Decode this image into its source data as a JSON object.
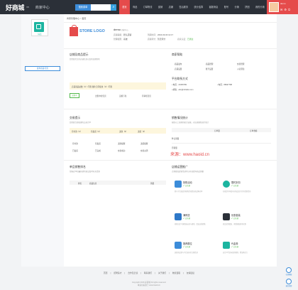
{
  "header": {
    "logo": "好商城",
    "logo_sup": "V5",
    "center_title": "商家中心",
    "search_select": "搜索菜单",
    "nav": [
      "首页",
      "商品",
      "订单物流",
      "促销",
      "店铺",
      "售后服务",
      "统计结算",
      "客服消息",
      "账号",
      "分销",
      "拼团",
      "我的分销",
      "账号服务",
      "账号权限",
      "装修",
      "帮助",
      "官方通道",
      "其它"
    ],
    "active_nav": 0,
    "username": "demo"
  },
  "sidebar": {
    "shop_logo_caption": "好店",
    "publish_button": "发布商品/宝贝"
  },
  "main": {
    "breadcrumb": "商家管理中心 > 首页",
    "store_logo_text": "STORE LOGO",
    "shop_name": "demo",
    "shop_name_badge": "商家中心",
    "shop_level_label": "店铺等级",
    "shop_level": "默认店铺",
    "shop_expire_label": "到期时间",
    "shop_expire": "2016-03-03 12:17",
    "shop_type_label": "管理权限",
    "shop_type": "系统",
    "audit_label": "店铺评分",
    "audit_value": "暂无评分",
    "verify_label": "商家认证",
    "verify_value": "已通过",
    "section_goods": {
      "title": "店铺及商品提示",
      "sub": "您需要关注的店铺信息以及待处理事项",
      "notice": "店铺商品总数（0）/不限   图片空间使用（0）/不限",
      "tag": "出售中",
      "items": [
        "出售中的宝贝",
        "违规下架",
        "待审核宝贝"
      ]
    },
    "section_news": {
      "title": "商家帮助",
      "items": [
        "商品发布",
        "商品管理",
        "交易管理",
        "店铺设置",
        "账号设置",
        "入驻须知"
      ]
    },
    "section_contact": {
      "title": "平台联系方式",
      "phone_label": "电话：",
      "phone": "23456789",
      "mobile_label": "电话：",
      "mobile": "88997788",
      "email_label": "邮箱：",
      "email": "abc@123abc.com"
    },
    "section_orders": {
      "title": "交易提示",
      "sub": "您需要立即处理的交易订单",
      "tabs": [
        "待付款（0）",
        "待发货（0）",
        "退款（0）",
        "退货（0）"
      ],
      "items": [
        "待付款",
        "待发货",
        "退款提醒",
        "退货提醒",
        "已发货",
        "已完成",
        "交易成功",
        "交易关闭"
      ]
    },
    "section_sales": {
      "title": "销售情况统计",
      "sub": "按照以上日期的统计结果，对店铺销售进行统计",
      "col1": "订单量",
      "col2": "订单金额",
      "rows": [
        "昨日销量",
        "月销量"
      ]
    },
    "section_rank": {
      "title": "单品销售排名",
      "sub": "掌握近30日最热销的商品及时补充货源",
      "cols": [
        "排名",
        "商品信息",
        "销量"
      ]
    },
    "section_promo": {
      "title": "店铺运营推广",
      "sub": "合理参加促销活动可以有效提升商品销量",
      "tiles": [
        {
          "title": "抢购活动",
          "status": "已开通",
          "desc": "参与平台发起的抢购活动提高商品曝光率"
        },
        {
          "title": "限时折扣",
          "status": "已开通",
          "desc": "在规定时间段内对商品实行打折促销活动"
        },
        {
          "title": "满即送",
          "status": "已开通",
          "desc": "商家自定义满即送标准与规则，促进店铺销售"
        },
        {
          "title": "优惠套装",
          "status": "已开通",
          "desc": "商品优惠套装、多重搭配更多实惠"
        },
        {
          "title": "推荐展位",
          "status": "已开通",
          "desc": "选择商品参与平台发布的主题活动"
        },
        {
          "title": "代金券",
          "status": "已开通",
          "desc": "自定义代金券使用规则，增加购买力"
        }
      ]
    },
    "watermark": "来源：www.haoid.cn"
  },
  "footer": {
    "links": [
      "首页",
      "招聘英才",
      "合作及洽谈",
      "联系我们",
      "关于我们",
      "物流自取",
      "友情链接"
    ],
    "copyright": "Copyright 2016 好商城 All rights reserved.",
    "powered": "本演示来源于 www.haoid.cn"
  },
  "floats": [
    "在线客服",
    "返回顶部"
  ],
  "colors": {
    "header": "#2b3038",
    "accent": "#e54b4b",
    "link": "#3c8cd9",
    "success": "#51b84a"
  }
}
